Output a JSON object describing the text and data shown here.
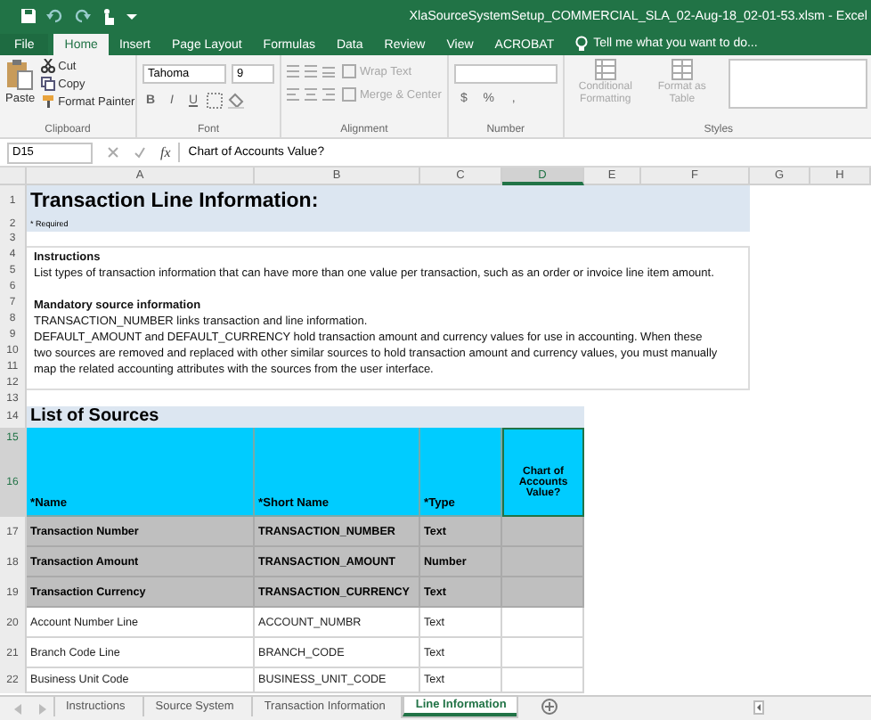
{
  "window": {
    "title": "XlaSourceSystemSetup_COMMERCIAL_SLA_02-Aug-18_02-01-53.xlsm - Excel"
  },
  "ribbon_tabs": [
    {
      "label": "File",
      "selected": false,
      "kind": "file"
    },
    {
      "label": "Home",
      "selected": true,
      "kind": "tab"
    },
    {
      "label": "Insert",
      "selected": false,
      "kind": "tab"
    },
    {
      "label": "Page Layout",
      "selected": false,
      "kind": "tab"
    },
    {
      "label": "Formulas",
      "selected": false,
      "kind": "tab"
    },
    {
      "label": "Data",
      "selected": false,
      "kind": "tab"
    },
    {
      "label": "Review",
      "selected": false,
      "kind": "tab"
    },
    {
      "label": "View",
      "selected": false,
      "kind": "tab"
    },
    {
      "label": "ACROBAT",
      "selected": false,
      "kind": "tab"
    }
  ],
  "tell_me": {
    "placeholder": "Tell me what you want to do..."
  },
  "ribbon": {
    "paste": "Paste",
    "cut": "Cut",
    "copy": "Copy",
    "format_painter": "Format Painter",
    "clipboard_label": "Clipboard",
    "font_name": "Tahoma",
    "font_size": "9",
    "font_buttons": [
      "B",
      "I",
      "U"
    ],
    "font_label": "Font",
    "wrap_text": {
      "label": "Wrap Text",
      "disabled": true
    },
    "merge_center": {
      "label": "Merge & Center",
      "disabled": true
    },
    "alignment_label": "Alignment",
    "number_buttons": [
      "$",
      "%",
      ","
    ],
    "number_label": "Number",
    "conditional_formatting": {
      "label": "Conditional Formatting",
      "disabled": true
    },
    "format_as_table": {
      "label": "Format as Table",
      "disabled": true
    },
    "styles_label": "Styles"
  },
  "name_box": "D15",
  "function_label": "fx",
  "formula": "Chart of Accounts Value?",
  "column_headers": [
    {
      "label": "A",
      "selected": false
    },
    {
      "label": "B",
      "selected": false
    },
    {
      "label": "C",
      "selected": false
    },
    {
      "label": "D",
      "selected": true
    },
    {
      "label": "E",
      "selected": false
    },
    {
      "label": "F",
      "selected": false
    },
    {
      "label": "G",
      "selected": false
    },
    {
      "label": "H",
      "selected": false
    }
  ],
  "row_headers": [
    {
      "label": "1",
      "selected": false
    },
    {
      "label": "2",
      "selected": false
    },
    {
      "label": "3",
      "selected": false
    },
    {
      "label": "4",
      "selected": false
    },
    {
      "label": "5",
      "selected": false
    },
    {
      "label": "6",
      "selected": false
    },
    {
      "label": "7",
      "selected": false
    },
    {
      "label": "8",
      "selected": false
    },
    {
      "label": "9",
      "selected": false
    },
    {
      "label": "10",
      "selected": false
    },
    {
      "label": "11",
      "selected": false
    },
    {
      "label": "12",
      "selected": false
    },
    {
      "label": "13",
      "selected": false
    },
    {
      "label": "14",
      "selected": false
    },
    {
      "label": "15",
      "selected": true
    },
    {
      "label": "16",
      "selected": true
    },
    {
      "label": "17",
      "selected": false
    },
    {
      "label": "18",
      "selected": false
    },
    {
      "label": "19",
      "selected": false
    },
    {
      "label": "20",
      "selected": false
    },
    {
      "label": "21",
      "selected": false
    },
    {
      "label": "22",
      "selected": false
    }
  ],
  "sheet": {
    "title": "Transaction Line Information:",
    "required_note": "* Required",
    "instructions_heading": "Instructions",
    "instructions_text": "List types of transaction information that can have more than one value per transaction, such as an order or invoice line item amount.",
    "mandatory_heading": "Mandatory source information",
    "mandatory_lines": [
      "TRANSACTION_NUMBER links transaction and line information.",
      "DEFAULT_AMOUNT and  DEFAULT_CURRENCY hold transaction amount and currency values for use in accounting. When these two sources are removed and replaced with other similar sources to hold transaction amount and currency values, you must manually map the related accounting attributes with the sources from the user interface."
    ],
    "list_title": "List of Sources",
    "columns": [
      "*Name",
      "*Short Name",
      "*Type",
      "Chart of Accounts Value?"
    ],
    "rows": [
      {
        "kind": "required",
        "cells": [
          "Transaction Number",
          "TRANSACTION_NUMBER",
          "Text"
        ]
      },
      {
        "kind": "required",
        "cells": [
          "Transaction Amount",
          "TRANSACTION_AMOUNT",
          "Number"
        ]
      },
      {
        "kind": "required",
        "cells": [
          "Transaction Currency",
          "TRANSACTION_CURRENCY",
          "Text"
        ]
      },
      {
        "kind": "optional",
        "cells": [
          "Account Number Line",
          "ACCOUNT_NUMBR",
          "Text"
        ]
      },
      {
        "kind": "optional",
        "cells": [
          "Branch Code Line",
          "BRANCH_CODE",
          "Text"
        ]
      },
      {
        "kind": "optional",
        "cells": [
          "Business Unit Code",
          "BUSINESS_UNIT_CODE",
          "Text"
        ]
      }
    ]
  },
  "sheet_tabs": [
    {
      "label": "Instructions",
      "selected": false
    },
    {
      "label": "Source System",
      "selected": false
    },
    {
      "label": "Transaction Information",
      "selected": false
    },
    {
      "label": "Line Information",
      "selected": true
    }
  ]
}
